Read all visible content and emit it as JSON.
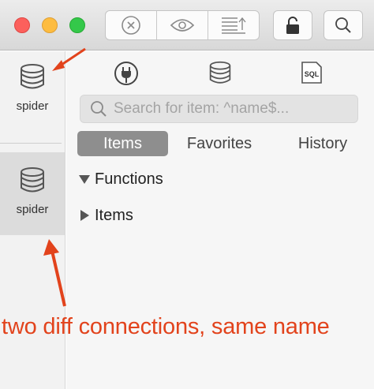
{
  "toolbar": {
    "segments": [
      "clear-icon",
      "eye-icon",
      "sort-up-icon"
    ],
    "lock_icon": "lock-icon",
    "search_icon": "search-icon"
  },
  "connections": [
    {
      "label": "spider",
      "icon": "database-icon",
      "selected": false
    },
    {
      "label": "spider",
      "icon": "database-icon",
      "selected": true
    }
  ],
  "panel_tabs": [
    {
      "icon": "plug-icon"
    },
    {
      "icon": "database-icon"
    },
    {
      "icon": "sql-icon",
      "text": "SQL"
    }
  ],
  "search": {
    "placeholder": "Search for item: ^name$...",
    "value": ""
  },
  "tabs": {
    "items": "Items",
    "favorites": "Favorites",
    "history": "History",
    "active": "Items"
  },
  "tree": [
    {
      "label": "Functions",
      "expanded": true
    },
    {
      "label": "Items",
      "expanded": false
    }
  ],
  "annotation": {
    "text": "two diff connections, same name",
    "color": "#e2431c"
  }
}
